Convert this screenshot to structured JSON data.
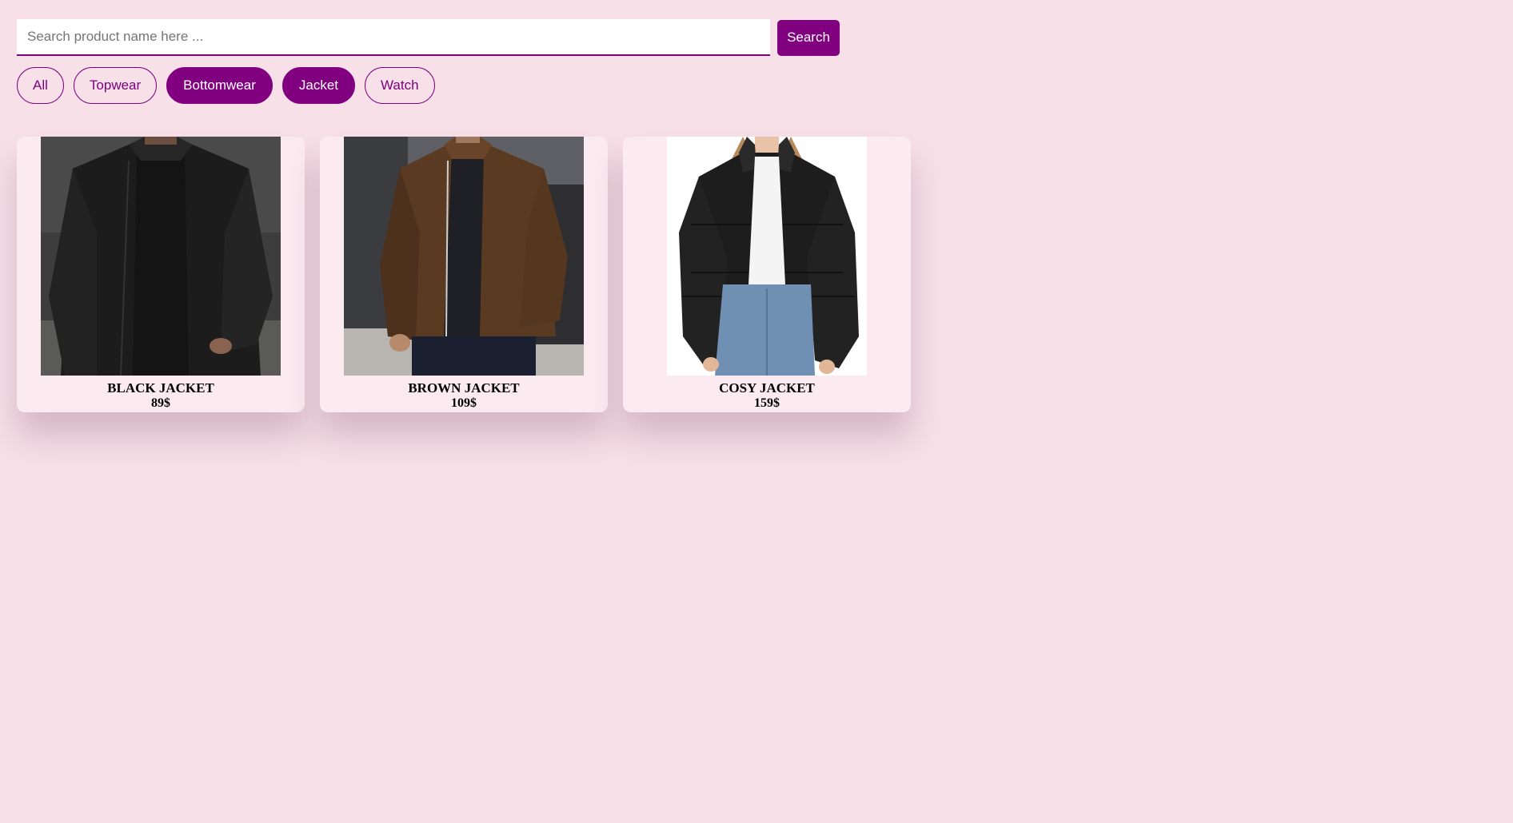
{
  "search": {
    "placeholder": "Search product name here ...",
    "value": "",
    "button_label": "Search"
  },
  "filters": [
    {
      "label": "All",
      "active": false
    },
    {
      "label": "Topwear",
      "active": false
    },
    {
      "label": "Bottomwear",
      "active": true
    },
    {
      "label": "Jacket",
      "active": true
    },
    {
      "label": "Watch",
      "active": false
    }
  ],
  "products": [
    {
      "name": "BLACK JACKET",
      "price": "89$",
      "image": "photo-black-leather-jacket"
    },
    {
      "name": "BROWN JACKET",
      "price": "109$",
      "image": "photo-brown-suede-jacket"
    },
    {
      "name": "COSY JACKET",
      "price": "159$",
      "image": "photo-black-puffer-jacket"
    }
  ],
  "colors": {
    "accent": "#800080",
    "background": "#f7e0e8",
    "card": "#fbeaf0"
  }
}
